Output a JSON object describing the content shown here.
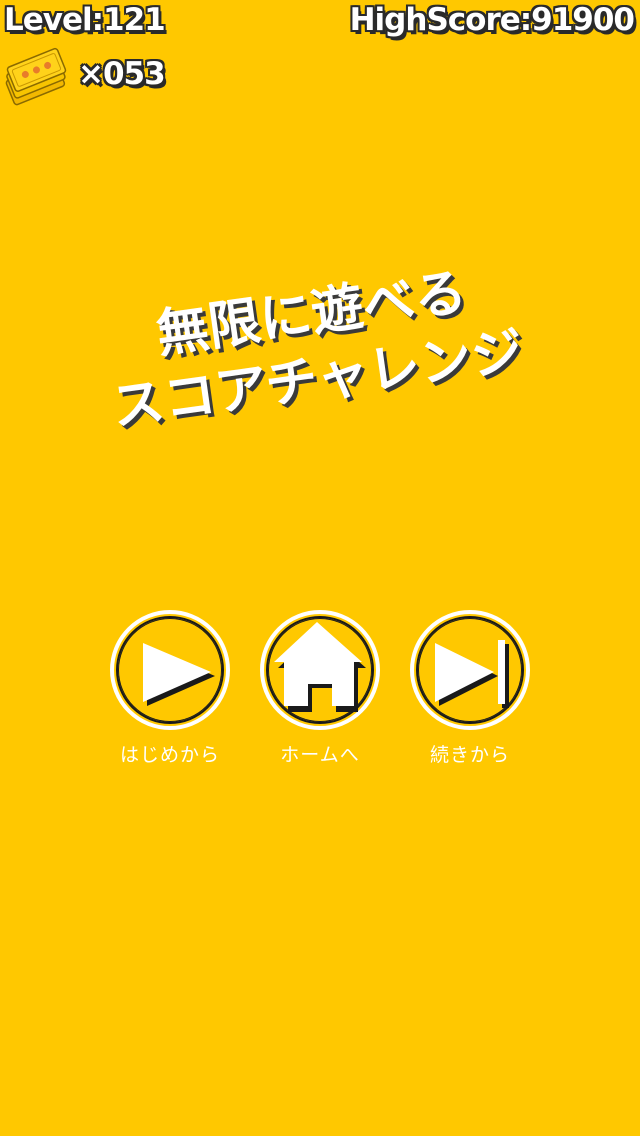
{
  "hud": {
    "level": "Level:121",
    "highscore": "HighScore:91900",
    "ticket_count": "×053",
    "ticket_icon": "ticket-stack-icon"
  },
  "headline": {
    "line1": "無限に遊べる",
    "line2": "スコアチャレンジ"
  },
  "buttons": {
    "start": {
      "label": "はじめから",
      "icon": "play-icon"
    },
    "home": {
      "label": "ホームへ",
      "icon": "home-icon"
    },
    "continue": {
      "label": "続きから",
      "icon": "skip-next-icon"
    }
  },
  "colors": {
    "background": "#FFC800",
    "text": "#FFFFFF",
    "outline": "#2A2A2A"
  }
}
